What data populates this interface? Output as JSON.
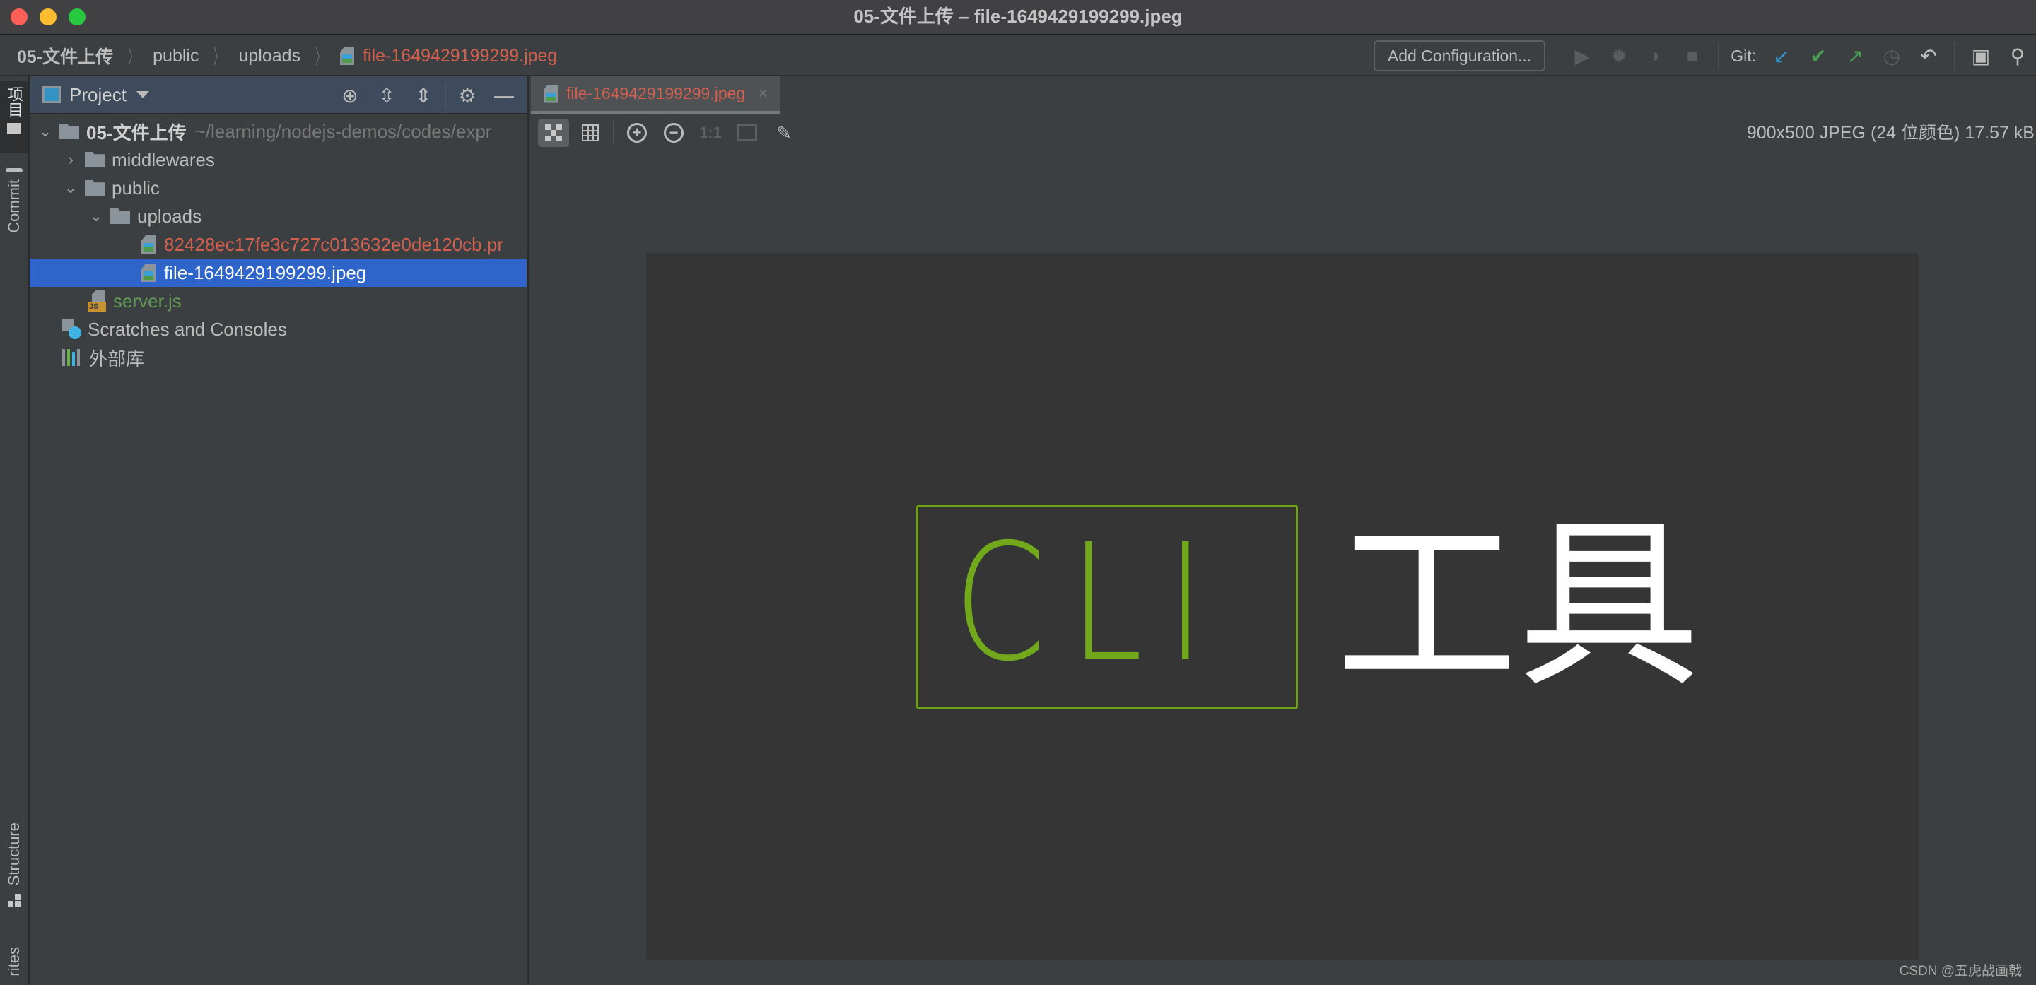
{
  "window": {
    "title": "05-文件上传 – file-1649429199299.jpeg"
  },
  "breadcrumb": [
    {
      "label": "05-文件上传"
    },
    {
      "label": "public"
    },
    {
      "label": "uploads"
    },
    {
      "label": "file-1649429199299.jpeg",
      "icon": "image-file-icon"
    }
  ],
  "toolbar": {
    "add_configuration": "Add Configuration...",
    "git_label": "Git:",
    "icons": [
      "run-icon",
      "debug-icon",
      "coverage-icon",
      "stop-icon",
      "git-update-icon",
      "git-commit-icon",
      "git-push-icon",
      "history-icon",
      "rollback-icon",
      "terminal-icon",
      "search-icon"
    ]
  },
  "left_strip": {
    "project_label": "项目",
    "commit_label": "Commit",
    "structure_label": "Structure",
    "favorites_label": "rites"
  },
  "project_panel": {
    "title": "Project",
    "header_icons": [
      "locate-icon",
      "expand-all-icon",
      "collapse-all-icon",
      "gear-icon",
      "minimize-icon"
    ],
    "tree": [
      {
        "label": "05-文件上传",
        "hint": "~/learning/nodejs-demos/codes/expr",
        "type": "folder",
        "expanded": true,
        "level": 0
      },
      {
        "label": "middlewares",
        "type": "folder",
        "expanded": false,
        "level": 1
      },
      {
        "label": "public",
        "type": "folder",
        "expanded": true,
        "level": 1
      },
      {
        "label": "uploads",
        "type": "folder",
        "expanded": true,
        "level": 2
      },
      {
        "label": "82428ec17fe3c727c013632e0de120cb.pr",
        "type": "image",
        "level": 3,
        "status": "unversioned"
      },
      {
        "label": "file-1649429199299.jpeg",
        "type": "image",
        "level": 3,
        "selected": true
      },
      {
        "label": "server.js",
        "type": "js",
        "level": 1,
        "status": "added"
      },
      {
        "label": "Scratches and Consoles",
        "type": "scratches",
        "level": 0
      },
      {
        "label": "外部库",
        "type": "library",
        "level": 0
      }
    ]
  },
  "editor": {
    "tab": {
      "label": "file-1649429199299.jpeg",
      "close": "×"
    },
    "image_toolbar": {
      "buttons": [
        "chessboard-icon",
        "grid-icon",
        "zoom-in-icon",
        "zoom-out-icon",
        "actual-size-icon",
        "fit-zoom-icon",
        "color-picker-icon"
      ],
      "actual_size_label": "1:1"
    },
    "image_info": "900x500 JPEG (24 位颜色) 17.57 kB",
    "image_content": {
      "boxed_text": "CLI",
      "text": "工具",
      "accent_color": "#72a81c"
    }
  },
  "watermark": "CSDN @五虎战画戟"
}
